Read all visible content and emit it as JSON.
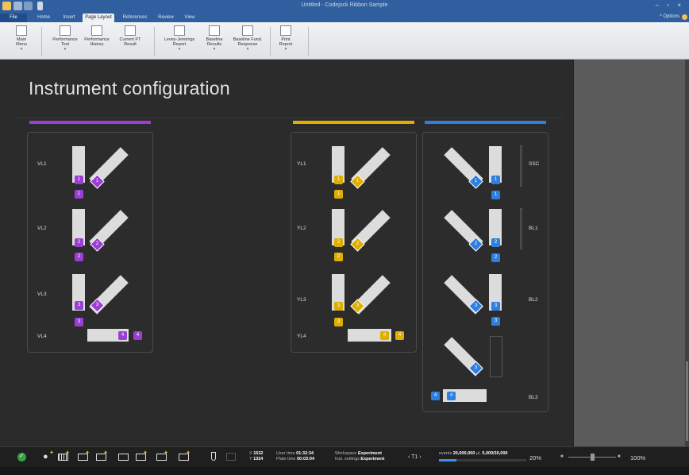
{
  "app": {
    "window_title": "Untitled - Codejock Ribbon Sample",
    "options_label": "Options"
  },
  "tabs": [
    "File",
    "Home",
    "Insert",
    "Page Layout",
    "References",
    "Review",
    "View"
  ],
  "ribbon": {
    "buttons": [
      {
        "l1": "Main",
        "l2": "Menu"
      },
      {
        "l1": "Performance",
        "l2": "Test"
      },
      {
        "l1": "Performance",
        "l2": "History"
      },
      {
        "l1": "Current PT",
        "l2": "Result"
      },
      {
        "l1": "Levey-Jennings",
        "l2": "Report"
      },
      {
        "l1": "Baseline",
        "l2": "Results"
      },
      {
        "l1": "Baseline Fund.",
        "l2": "Response"
      },
      {
        "l1": "Print",
        "l2": "Report"
      }
    ]
  },
  "page": {
    "title": "Instrument configuration"
  },
  "colors": {
    "violet": "#9b3fd4",
    "yellow": "#e0ae00",
    "blue": "#2f7fe0"
  },
  "violet_panel": {
    "rows": [
      {
        "label": "VL1",
        "n": "1"
      },
      {
        "label": "VL2",
        "n": "2"
      },
      {
        "label": "VL3",
        "n": "3"
      },
      {
        "label": "VL4",
        "n": "4"
      }
    ]
  },
  "yellow_panel": {
    "rows": [
      {
        "label": "YL1",
        "n": "1"
      },
      {
        "label": "YL2",
        "n": "2"
      },
      {
        "label": "YL3",
        "n": "3"
      },
      {
        "label": "YL4",
        "n": "4"
      }
    ]
  },
  "blue_panel": {
    "rows": [
      {
        "label": "SSC",
        "n": "1"
      },
      {
        "label": "BL1",
        "n": "2"
      },
      {
        "label": "BL2",
        "n": "3"
      },
      {
        "label": "BL3",
        "n": "4"
      }
    ],
    "extra_badge": "3"
  },
  "status": {
    "x_label": "X",
    "x_val": "1532",
    "y_label": "Y",
    "y_val": "1324",
    "user_time_label": "User time",
    "user_time": "01:32:34",
    "plate_time_label": "Plate time",
    "plate_time": "00:03:04",
    "workspace_label": "Workspace",
    "workspace": "Experiment",
    "inst_label": "Inst. settings",
    "inst": "Experiment",
    "tube": "‹ T1 ›",
    "events_label": "events",
    "events": "20,000,000",
    "vol_label": "µL",
    "vol": "5,000/30,000",
    "progress_percent": 20,
    "progress_text": "20%",
    "zoom": "100%"
  }
}
